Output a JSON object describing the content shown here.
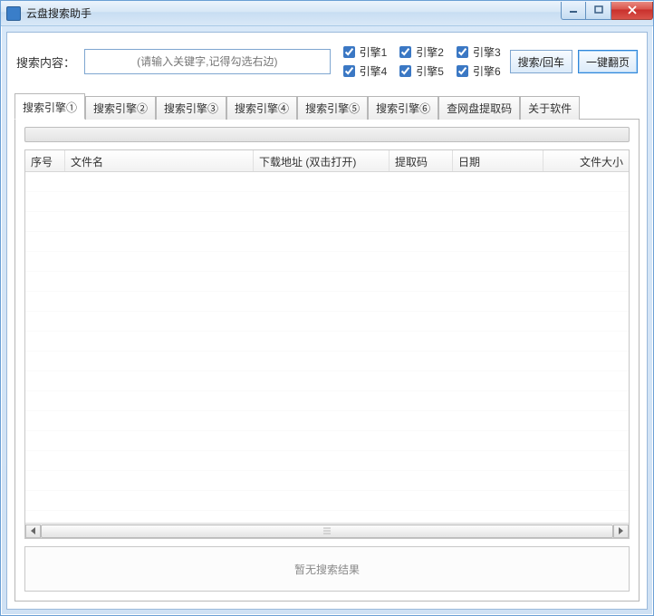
{
  "window": {
    "title": "云盘搜索助手"
  },
  "search": {
    "label": "搜索内容：",
    "placeholder": "(请输入关键字,记得勾选右边)",
    "engines": [
      "引擎1",
      "引擎2",
      "引擎3",
      "引擎4",
      "引擎5",
      "引擎6"
    ],
    "btn_search": "搜索/回车",
    "btn_next": "一键翻页"
  },
  "tabs": [
    "搜索引擎①",
    "搜索引擎②",
    "搜索引擎③",
    "搜索引擎④",
    "搜索引擎⑤",
    "搜索引擎⑥",
    "查网盘提取码",
    "关于软件"
  ],
  "columns": {
    "seq": "序号",
    "name": "文件名",
    "url": "下载地址 (双击打开)",
    "code": "提取码",
    "date": "日期",
    "size": "文件大小"
  },
  "status": "暂无搜索结果"
}
